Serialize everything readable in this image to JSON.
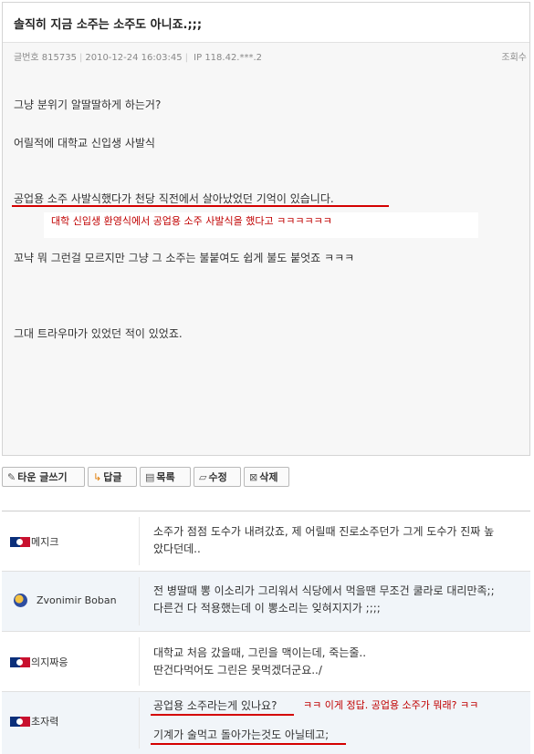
{
  "post": {
    "title": "솔직히 지금 소주는 소주도 아니죠.;;;",
    "meta": {
      "no_label": "글번호",
      "no": "815735",
      "date": "2010-12-24 16:03:45",
      "ip_label": "IP",
      "ip": "118.42.***.2",
      "views_label": "조회수"
    },
    "body": [
      "그냥 분위기 알딸딸하게 하는거?",
      "어릴적에 대학교 신입생 사발식",
      "공업용 소주 사발식했다가 천당 직전에서 살아났었던 기억이 있습니다.",
      "꼬냑 뭐 그런걸 모르지만 그냥 그 소주는 불붙여도 쉽게 불도 붙엇죠 ㅋㅋㅋ",
      "그대 트라우마가 있었던 적이 있었죠."
    ],
    "annotation": "대학 신입생 환영식에서 공업용 소주 사발식을 했다고 ㅋㅋㅋㅋㅋㅋ",
    "colors": {
      "annotation_red": "#c00000",
      "underline_red": "#d40000"
    }
  },
  "toolbar": {
    "write_icon": "pencil-icon",
    "write_label": "타운 글쓰기",
    "reply_icon": "reply-arrow-icon",
    "reply_label": "답글",
    "list_icon": "list-icon",
    "list_label": "목록",
    "edit_icon": "edit-icon",
    "edit_label": "수정",
    "delete_icon": "close-box-icon",
    "delete_label": "삭제"
  },
  "comments": [
    {
      "author": "메지크",
      "badge": "mlb-logo-icon",
      "lines": [
        "소주가 점점 도수가 내려갔죠, 제 어릴때 진로소주던가 그게 도수가 진짜 높",
        "았다던데.."
      ]
    },
    {
      "author": "Zvonimir Boban",
      "badge": "baseball-avatar-icon",
      "lines": [
        "전 병딸때 뽕 이소리가 그리워서 식당에서 먹을땐 무조건 쿨라로 대리만족;;",
        "다른건 다 적용했는데 이 뽕소리는 잊혀지지가 ;;;;"
      ]
    },
    {
      "author": "의지짜응",
      "badge": "mlb-logo-icon",
      "lines": [
        "대학교 처음 갔을때, 그린을 맥이는데, 죽는줄..",
        "딴건다먹어도 그린은 못먹겠더군요../"
      ]
    },
    {
      "author": "초자력",
      "badge": "mlb-logo-icon",
      "lines": [
        "공업용 소주라는게 있나요?",
        "기계가 술먹고 돌아가는것도 아닐테고;"
      ],
      "annotation": "ㅋㅋ 이게 정답. 공업용 소주가 뭐래? ㅋㅋ"
    }
  ]
}
